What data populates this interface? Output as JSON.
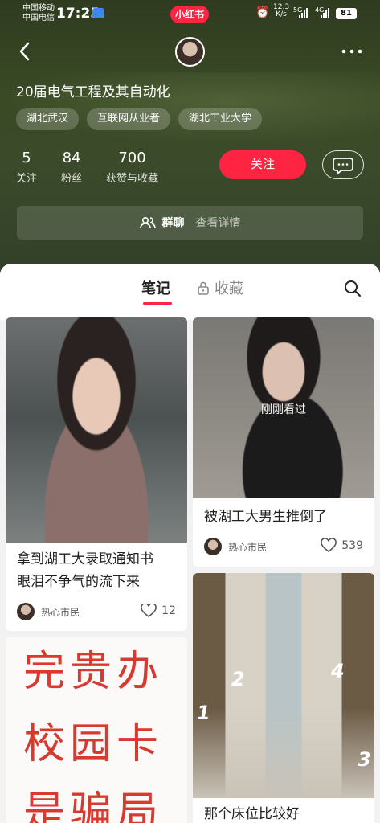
{
  "status_bar": {
    "carrier_1": "中国移动",
    "carrier_2": "中国电信",
    "time": "17:25",
    "app_badge": "小红书",
    "net_speed": "12.3",
    "net_unit": "K/s",
    "signal_1_label": "5G",
    "signal_2_label": "4G",
    "battery": "81"
  },
  "profile": {
    "bio": "20届电气工程及其自动化",
    "tags": [
      "湖北武汉",
      "互联网从业者",
      "湖北工业大学"
    ],
    "stats": [
      {
        "value": "5",
        "label": "关注"
      },
      {
        "value": "84",
        "label": "粉丝"
      },
      {
        "value": "700",
        "label": "获赞与收藏"
      }
    ],
    "follow_label": "关注",
    "group_chat": {
      "title": "群聊",
      "detail": "查看详情"
    }
  },
  "tabs": {
    "notes": "笔记",
    "collections": "收藏"
  },
  "cards": [
    {
      "title_line1": "拿到湖工大录取通知书",
      "title_line2": "眼泪不争气的流下来",
      "author": "热心市民",
      "likes": "12"
    },
    {
      "overlay": "刚刚看过",
      "title": "被湖工大男生推倒了",
      "author": "热心市民",
      "likes": "539"
    },
    {
      "marks": [
        "1",
        "2",
        "3",
        "4"
      ],
      "title": "那个床位比较好"
    },
    {
      "handwriting_line1": "完贵办",
      "handwriting_line2": "校园卡",
      "handwriting_line3": "是骗局"
    }
  ],
  "colors": {
    "accent": "#ff2442",
    "header_bg": "#3a4a25"
  },
  "icons": [
    "back-icon",
    "more-icon",
    "message-icon",
    "group-icon",
    "lock-icon",
    "search-icon",
    "heart-icon",
    "alarm-icon"
  ]
}
